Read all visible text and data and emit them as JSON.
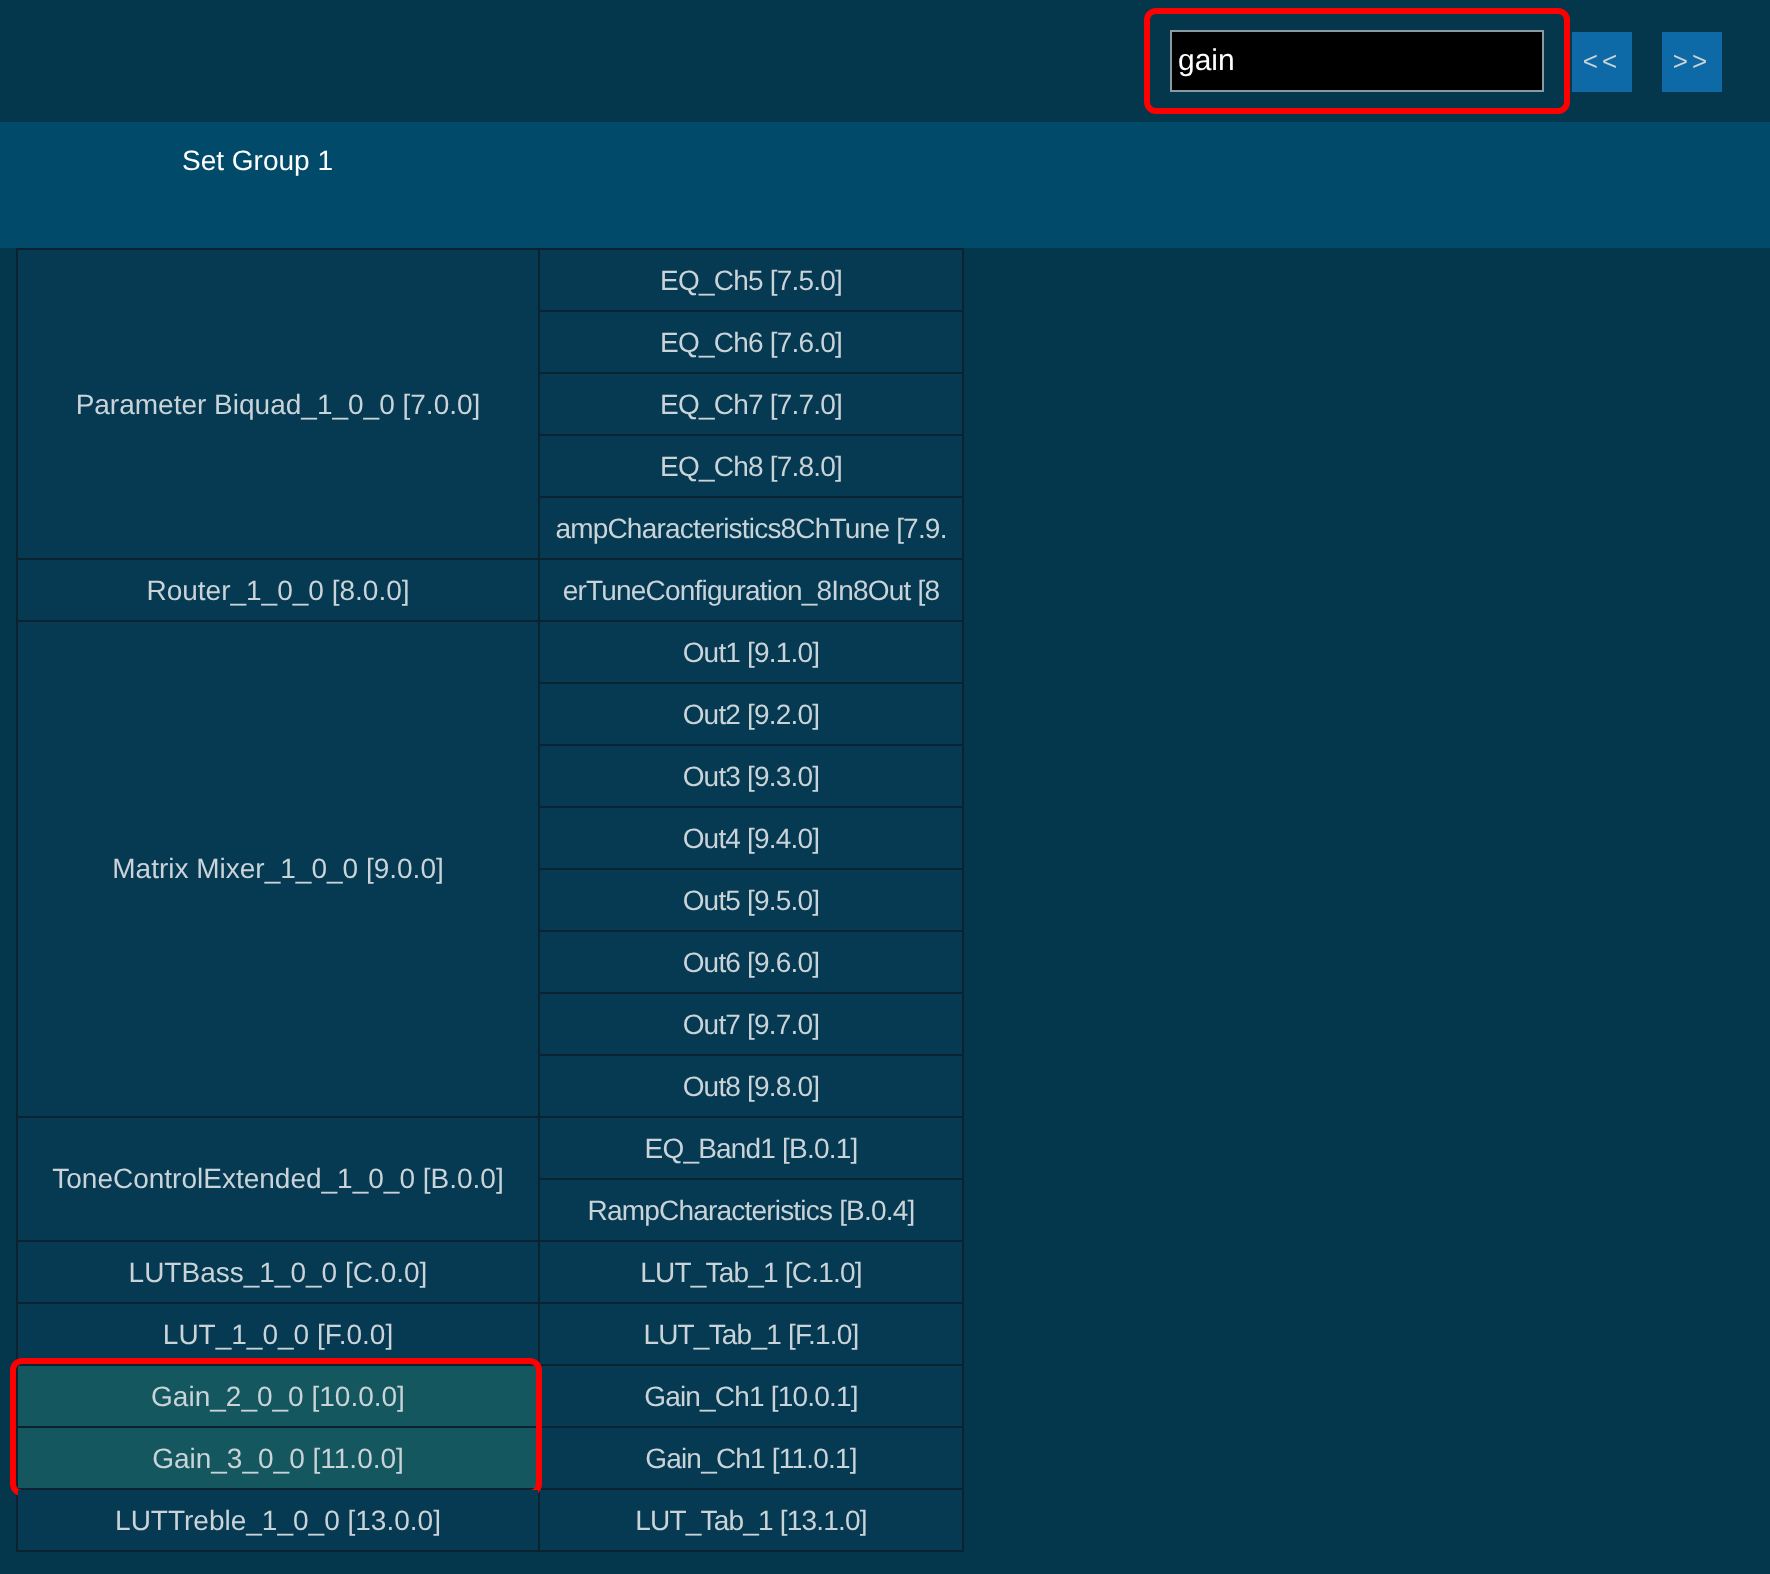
{
  "search": {
    "value": "gain",
    "marked": true
  },
  "nav_buttons": [
    "<<",
    ">>"
  ],
  "group_header": "Set Group 1",
  "groups": [
    {
      "name": "Parameter Biquad_1_0_0 [7.0.0]",
      "highlighted": false,
      "marked": false,
      "children": [
        "EQ_Ch5 [7.5.0]",
        "EQ_Ch6 [7.6.0]",
        "EQ_Ch7 [7.7.0]",
        "EQ_Ch8 [7.8.0]",
        "ampCharacteristics8ChTune [7.9."
      ]
    },
    {
      "name": "Router_1_0_0 [8.0.0]",
      "highlighted": false,
      "marked": false,
      "children": [
        "erTuneConfiguration_8In8Out [8"
      ]
    },
    {
      "name": "Matrix Mixer_1_0_0 [9.0.0]",
      "highlighted": false,
      "marked": false,
      "children": [
        "Out1 [9.1.0]",
        "Out2 [9.2.0]",
        "Out3 [9.3.0]",
        "Out4 [9.4.0]",
        "Out5 [9.5.0]",
        "Out6 [9.6.0]",
        "Out7 [9.7.0]",
        "Out8 [9.8.0]"
      ]
    },
    {
      "name": "ToneControlExtended_1_0_0 [B.0.0]",
      "highlighted": false,
      "marked": false,
      "children": [
        "EQ_Band1 [B.0.1]",
        "RampCharacteristics [B.0.4]"
      ]
    },
    {
      "name": "LUTBass_1_0_0 [C.0.0]",
      "highlighted": false,
      "marked": false,
      "children": [
        "LUT_Tab_1 [C.1.0]"
      ]
    },
    {
      "name": "LUT_1_0_0 [F.0.0]",
      "highlighted": false,
      "marked": false,
      "children": [
        "LUT_Tab_1 [F.1.0]"
      ]
    },
    {
      "name": "Gain_2_0_0 [10.0.0]",
      "highlighted": true,
      "marked": true,
      "children": [
        "Gain_Ch1 [10.0.1]"
      ]
    },
    {
      "name": "Gain_3_0_0 [11.0.0]",
      "highlighted": true,
      "marked": true,
      "children": [
        "Gain_Ch1 [11.0.1]"
      ]
    },
    {
      "name": "LUTTreble_1_0_0 [13.0.0]",
      "highlighted": false,
      "marked": false,
      "children": [
        "LUT_Tab_1 [13.1.0]"
      ]
    }
  ]
}
